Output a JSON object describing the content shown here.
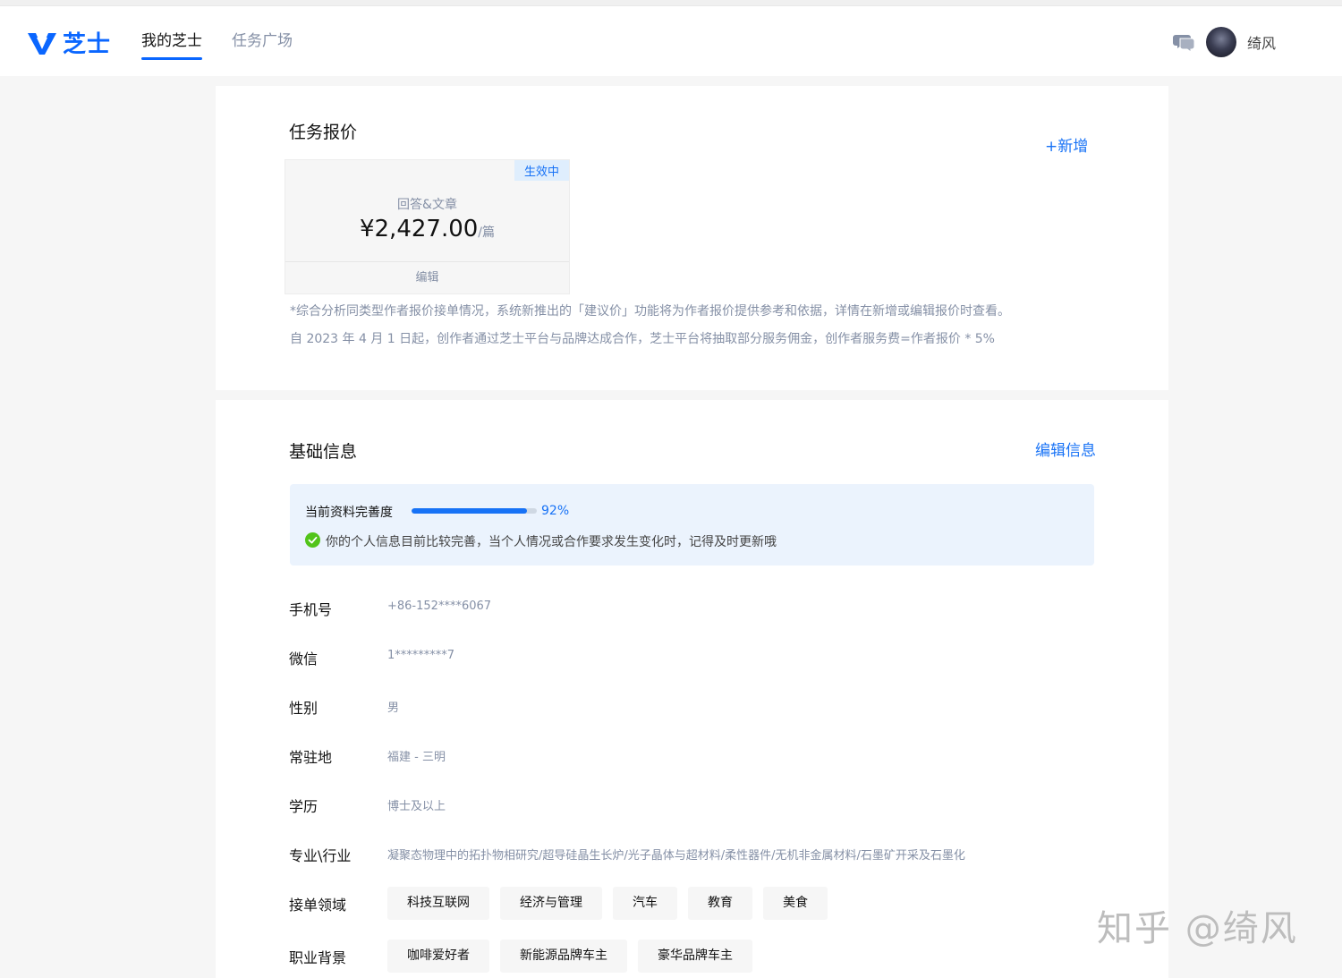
{
  "header": {
    "logo_text": "芝士",
    "nav": [
      "我的芝士",
      "任务广场"
    ],
    "username": "绮风"
  },
  "quote_section": {
    "title": "任务报价",
    "add_label": "+新增",
    "card": {
      "badge": "生效中",
      "type": "回答&文章",
      "price": "¥2,427.00",
      "unit": "/篇",
      "edit_label": "编辑"
    },
    "notes": [
      "*综合分析同类型作者报价接单情况，系统新推出的「建议价」功能将为作者报价提供参考和依据，详情在新增或编辑报价时查看。",
      "自 2023 年 4 月 1 日起，创作者通过芝士平台与品牌达成合作，芝士平台将抽取部分服务佣金，创作者服务费=作者报价 * 5%"
    ]
  },
  "basic_section": {
    "title": "基础信息",
    "edit_label": "编辑信息",
    "completeness": {
      "label": "当前资料完善度",
      "value": 92,
      "value_text": "92%",
      "tip": "你的个人信息目前比较完善，当个人情况或合作要求发生变化时，记得及时更新哦"
    },
    "fields": [
      {
        "label": "手机号",
        "value": "+86-152****6067"
      },
      {
        "label": "微信",
        "value": "1*********7"
      },
      {
        "label": "性别",
        "value": "男"
      },
      {
        "label": "常驻地",
        "value": "福建 - 三明"
      },
      {
        "label": "学历",
        "value": "博士及以上"
      },
      {
        "label": "专业\\行业",
        "value": "凝聚态物理中的拓扑物相研究/超导硅晶生长炉/光子晶体与超材料/柔性器件/无机非金属材料/石墨矿开采及石墨化"
      }
    ],
    "domains": {
      "label": "接单领域",
      "tags": [
        "科技互联网",
        "经济与管理",
        "汽车",
        "教育",
        "美食"
      ]
    },
    "backgrounds": {
      "label": "职业背景",
      "tags": [
        "咖啡爱好者",
        "新能源品牌车主",
        "豪华品牌车主"
      ]
    }
  },
  "watermark": "知乎 @绮风",
  "colors": {
    "accent": "#1772f6",
    "brand": "#0a66ff",
    "success": "#52c41a"
  }
}
